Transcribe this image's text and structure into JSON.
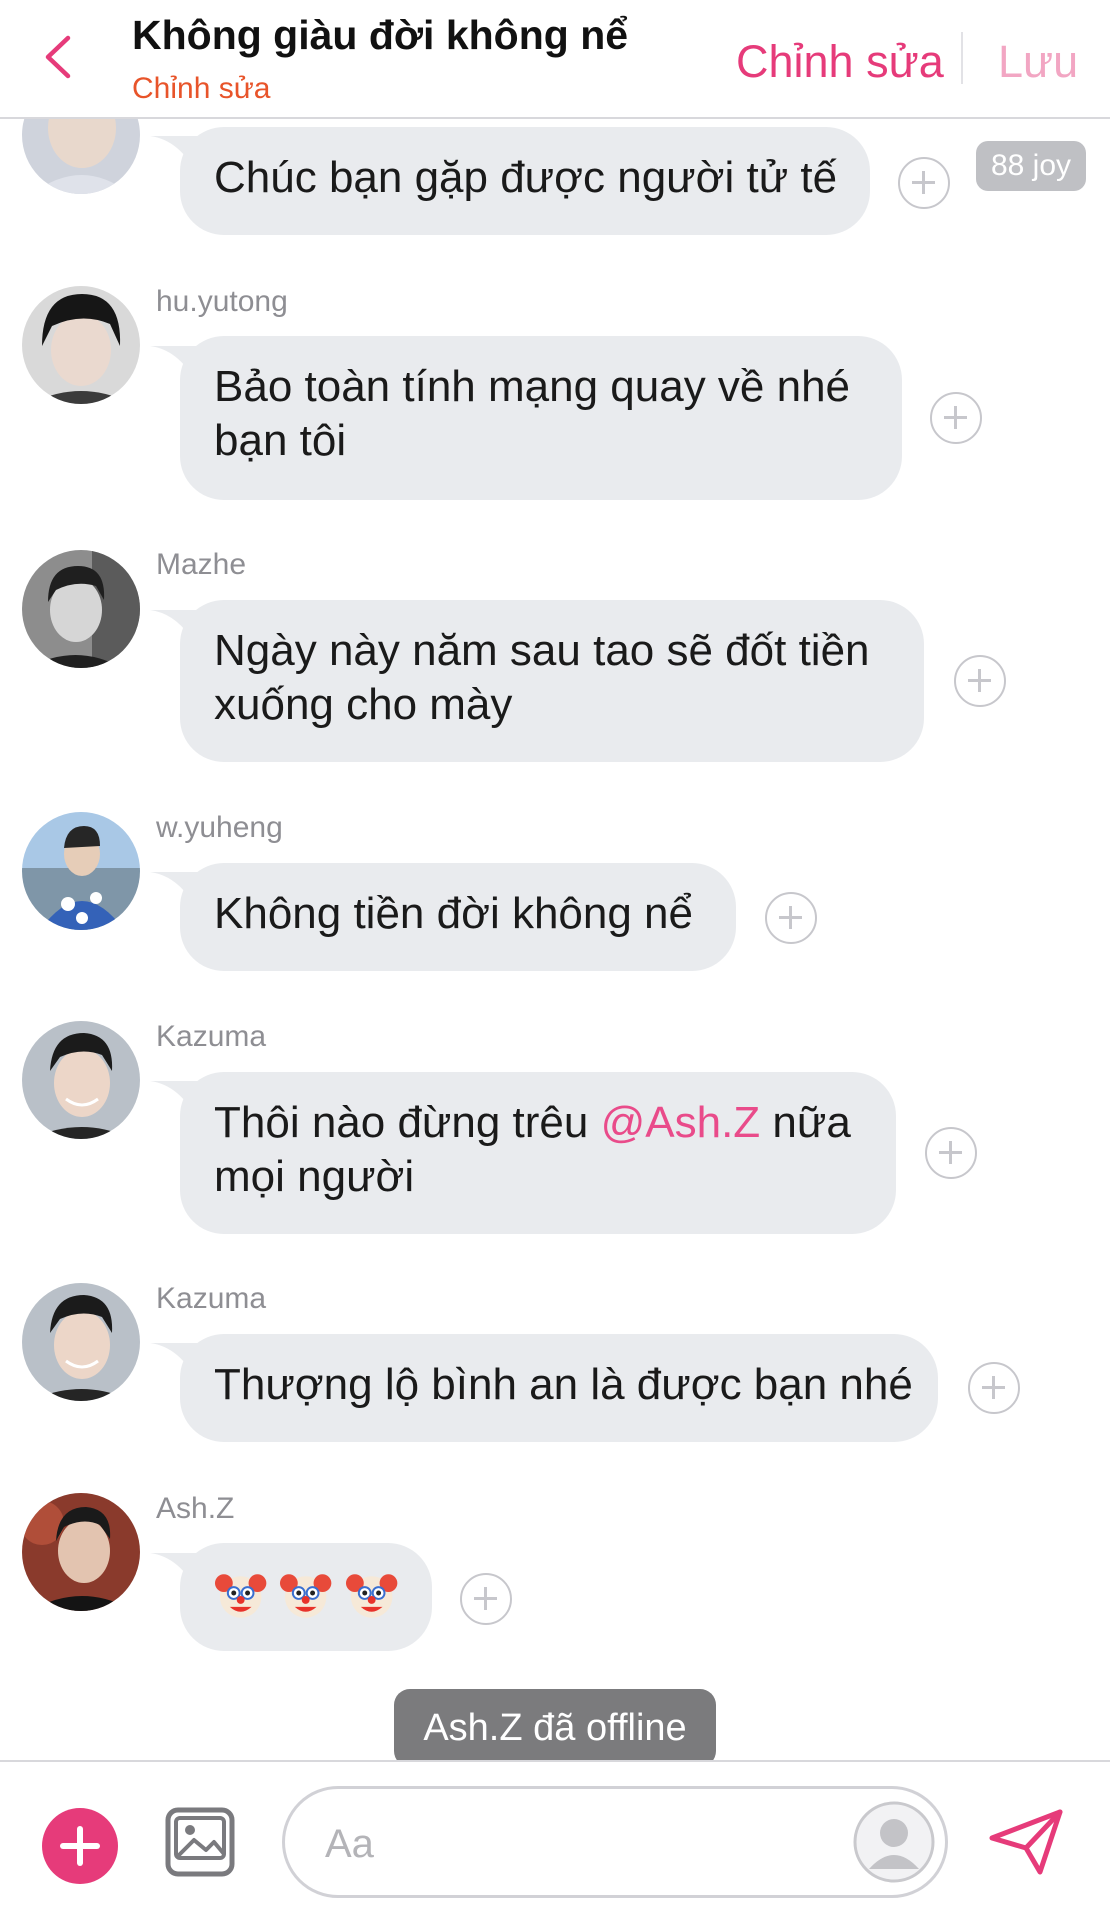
{
  "header": {
    "title": "Không giàu đời không nể",
    "subtitle": "Chỉnh sửa",
    "edit_label": "Chỉnh sửa",
    "save_label": "Lưu"
  },
  "messages": [
    {
      "sender": "",
      "text": "Chúc bạn gặp được người tử tế",
      "reaction_badge": "88 joy"
    },
    {
      "sender": "hu.yutong",
      "lines": [
        "Bảo toàn tính mạng quay về nhé",
        "bạn tôi"
      ]
    },
    {
      "sender": "Mazhe",
      "lines": [
        "Ngày này năm sau tao sẽ đốt tiền",
        "xuống cho mày"
      ]
    },
    {
      "sender": "w.yuheng",
      "text": "Không tiền đời không nể"
    },
    {
      "sender": "Kazuma",
      "line1_before": "Thôi nào đừng trêu ",
      "mention": "@Ash.Z",
      "line1_after": " nữa",
      "line2": "mọi người"
    },
    {
      "sender": "Kazuma",
      "text": "Thượng lộ bình an là được bạn nhé"
    },
    {
      "sender": "Ash.Z",
      "emoji": [
        "clown-face",
        "clown-face",
        "clown-face"
      ]
    }
  ],
  "status": {
    "text": "Ash.Z đã offline"
  },
  "composer": {
    "placeholder": "Aa"
  },
  "icons": {
    "back": "chevron-left-icon",
    "add": "plus-icon",
    "image": "image-icon",
    "avatar_placeholder": "user-icon",
    "send": "send-icon",
    "react": "plus-circle-icon"
  },
  "colors": {
    "accent": "#e63b7a",
    "accent_light": "#f2a6c3",
    "subtitle": "#e8542a",
    "bubble": "#e9ebee",
    "mention": "#e94b8a"
  }
}
